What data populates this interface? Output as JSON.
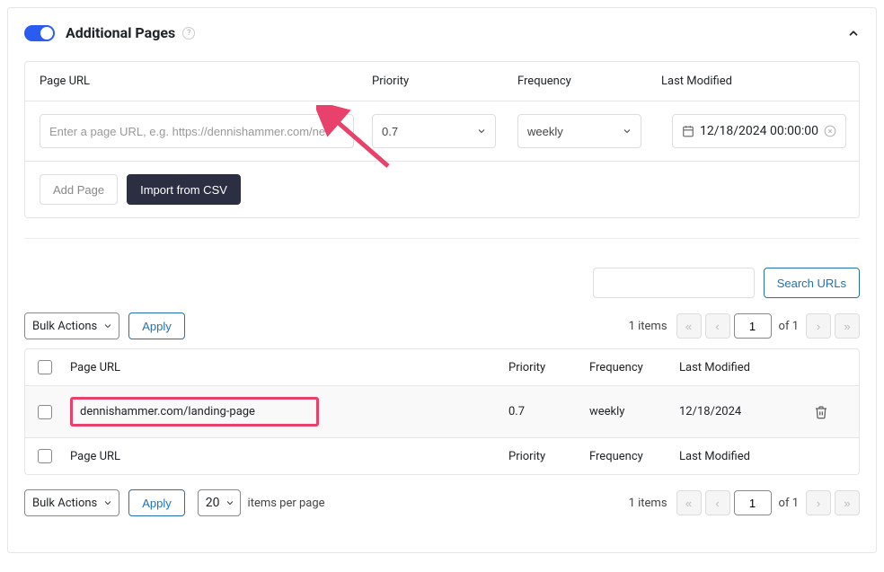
{
  "panel": {
    "title": "Additional Pages"
  },
  "form": {
    "headers": {
      "url": "Page URL",
      "priority": "Priority",
      "frequency": "Frequency",
      "modified": "Last Modified"
    },
    "url_placeholder": "Enter a page URL, e.g. https://dennishammer.com/ne",
    "priority_value": "0.7",
    "frequency_value": "weekly",
    "date_value": "12/18/2024 00:00:00",
    "add_btn": "Add Page",
    "import_btn": "Import from CSV"
  },
  "search": {
    "btn": "Search URLs"
  },
  "list": {
    "bulk_label": "Bulk Actions",
    "apply_label": "Apply",
    "items_text": "1 items",
    "page_current": "1",
    "page_of": "of 1",
    "headers": {
      "url": "Page URL",
      "priority": "Priority",
      "frequency": "Frequency",
      "modified": "Last Modified"
    },
    "row": {
      "url": "dennishammer.com/landing-page",
      "priority": "0.7",
      "frequency": "weekly",
      "modified": "12/18/2024"
    },
    "per_page_value": "20",
    "per_page_label": "items per page"
  }
}
